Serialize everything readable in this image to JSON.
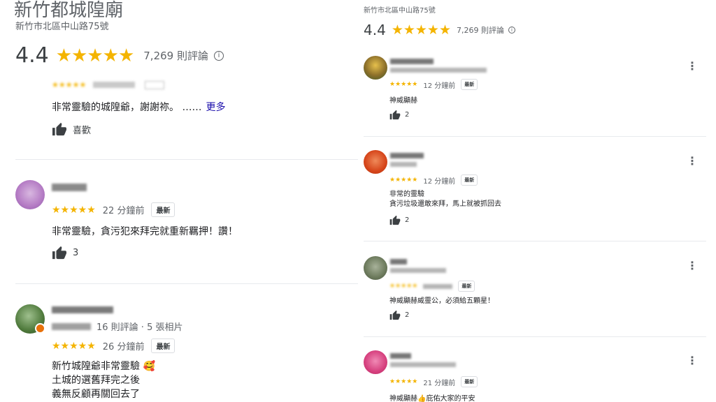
{
  "left": {
    "place_title": "新竹都城隍廟",
    "address": "新竹市北區中山路75號",
    "rating": "4.4",
    "stars": "★★★★★",
    "review_count": "7,269 則評論",
    "review0": {
      "text": "非常靈驗的城隍爺，謝謝祢。 ……",
      "more": "更多",
      "like_label": "喜歡"
    },
    "review1": {
      "time": "22 分鐘前",
      "badge": "最新",
      "text": "非常靈驗，貪污犯來拜完就重新羈押！讚！",
      "likes": "3"
    },
    "review2": {
      "meta": "16 則評論 · 5 張相片",
      "time": "26 分鐘前",
      "badge": "最新",
      "line1": "新竹城隍爺非常靈驗 🥰",
      "line2": "土城的選舊拜完之後",
      "line3": "義無反顧再關回去了"
    }
  },
  "right": {
    "address": "新竹市北區中山路75號",
    "rating": "4.4",
    "stars": "★★★★★",
    "review_count": "7,269 則評論",
    "reviews": [
      {
        "time": "12 分鐘前",
        "badge": "最新",
        "text": "神威顯赫",
        "likes": "2"
      },
      {
        "time": "12 分鐘前",
        "badge": "最新",
        "text": "非常的靈驗",
        "text2": "貪污垃圾還敢來拜，馬上就被抓回去",
        "likes": "2"
      },
      {
        "badge": "最新",
        "text": "神威顯赫威靈公，必須給五顆星！",
        "likes": "2"
      },
      {
        "time": "21 分鐘前",
        "badge": "最新",
        "text": "神威顯赫👍庇佑大家的平安"
      }
    ]
  },
  "colors": {
    "star": "#f4b400",
    "link": "#1a0dab",
    "text": "#202124",
    "muted": "#70757a"
  },
  "icons": [
    "info-icon",
    "thumbs-up-icon",
    "more-vert-icon",
    "avatar"
  ]
}
